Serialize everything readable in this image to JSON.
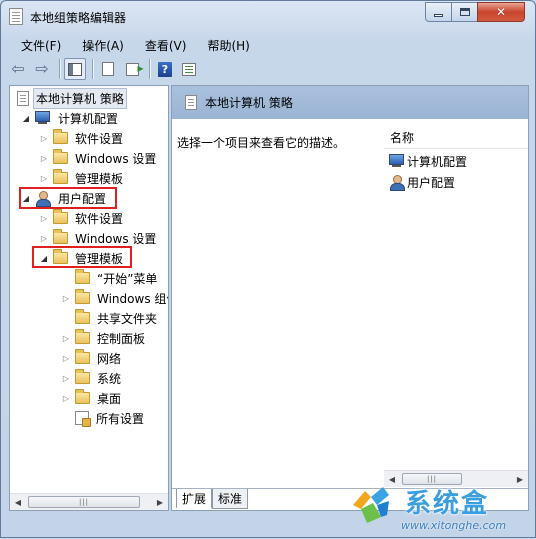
{
  "window": {
    "title": "本地组策略编辑器"
  },
  "menu": [
    "文件(F)",
    "操作(A)",
    "查看(V)",
    "帮助(H)"
  ],
  "toolbar": {
    "buttons": [
      "back-arrow-icon",
      "forward-arrow-icon",
      "show-tree-icon",
      "show-description-icon",
      "export-list-icon",
      "help-icon",
      "properties-icon"
    ]
  },
  "tree": {
    "root": "本地计算机 策略",
    "computer_config": "计算机配置",
    "computer_children": [
      "软件设置",
      "Windows 设置",
      "管理模板"
    ],
    "user_config": "用户配置",
    "user_children": [
      "软件设置",
      "Windows 设置",
      "管理模板"
    ],
    "admin_templates_children": [
      "“开始”菜单",
      "Windows 组件",
      "共享文件夹",
      "控制面板",
      "网络",
      "系统",
      "桌面",
      "所有设置"
    ]
  },
  "details": {
    "header": "本地计算机 策略",
    "description": "选择一个项目来查看它的描述。",
    "column_name": "名称",
    "items": [
      "计算机配置",
      "用户配置"
    ]
  },
  "tabs": [
    "扩展",
    "标准"
  ],
  "watermark": {
    "title": "系统盒",
    "url": "www.xitonghe.com"
  },
  "colors": {
    "highlight_box": "#e02020",
    "header_band": "#a9c1de"
  }
}
